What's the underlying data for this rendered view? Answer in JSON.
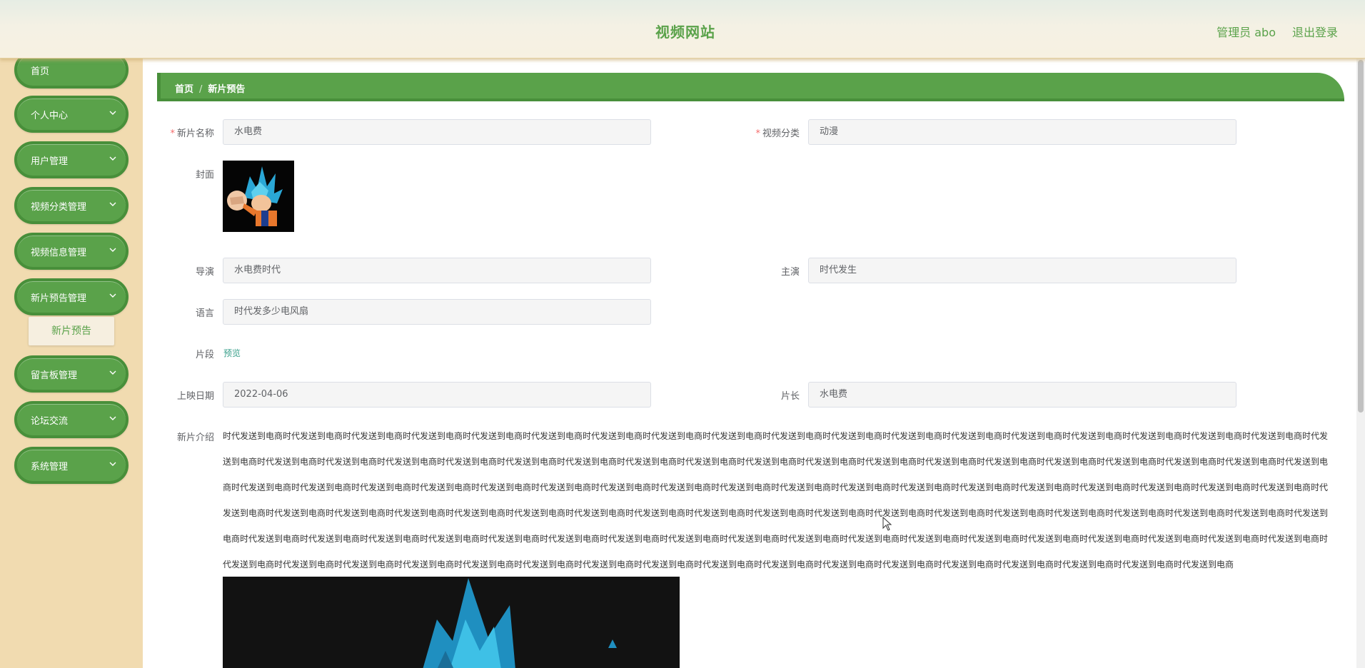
{
  "header": {
    "title": "视频网站",
    "user": "管理员 abo",
    "logout": "退出登录"
  },
  "sidebar": {
    "items": [
      {
        "label": "首页"
      },
      {
        "label": "个人中心"
      },
      {
        "label": "用户管理"
      },
      {
        "label": "视频分类管理"
      },
      {
        "label": "视频信息管理"
      },
      {
        "label": "新片预告管理"
      },
      {
        "label": "留言板管理"
      },
      {
        "label": "论坛交流"
      },
      {
        "label": "系统管理"
      }
    ],
    "submenu_active": "新片预告"
  },
  "breadcrumb": {
    "home": "首页",
    "separator": "/",
    "current": "新片预告"
  },
  "form": {
    "name_label": "新片名称",
    "name_value": "水电费",
    "category_label": "视频分类",
    "category_value": "动漫",
    "cover_label": "封面",
    "director_label": "导演",
    "director_value": "水电费时代",
    "actor_label": "主演",
    "actor_value": "时代发生",
    "language_label": "语言",
    "language_value": "时代发多少电风扇",
    "clip_label": "片段",
    "clip_link": "预览",
    "date_label": "上映日期",
    "date_value": "2022-04-06",
    "duration_label": "片长",
    "duration_value": "水电费",
    "intro_label": "新片介绍",
    "intro_text": "时代发送到电商时代发送到电商时代发送到电商时代发送到电商时代发送到电商时代发送到电商时代发送到电商时代发送到电商时代发送到电商时代发送到电商时代发送到电商时代发送到电商时代发送到电商时代发送到电商时代发送到电商时代发送到电商时代发送到电商时代发送到电商时代发送到电商时代发送到电商时代发送到电商时代发送到电商时代发送到电商时代发送到电商时代发送到电商时代发送到电商时代发送到电商时代发送到电商时代发送到电商时代发送到电商时代发送到电商时代发送到电商时代发送到电商时代发送到电商时代发送到电商时代发送到电商时代发送到电商时代发送到电商时代发送到电商时代发送到电商时代发送到电商时代发送到电商时代发送到电商时代发送到电商时代发送到电商时代发送到电商时代发送到电商时代发送到电商时代发送到电商时代发送到电商时代发送到电商时代发送到电商时代发送到电商时代发送到电商时代发送到电商时代发送到电商时代发送到电商时代发送到电商时代发送到电商时代发送到电商时代发送到电商时代发送到电商时代发送到电商时代发送到电商时代发送到电商时代发送到电商时代发送到电商时代发送到电商时代发送到电商时代发送到电商时代发送到电商时代发送到电商时代发送到电商时代发送到电商时代发送到电商时代发送到电商时代发送到电商时代发送到电商时代发送到电商时代发送到电商时代发送到电商时代发送到电商时代发送到电商时代发送到电商时代发送到电商时代发送到电商时代发送到电商时代发送到电商时代发送到电商时代发送到电商时代发送到电商时代发送到电商时代发送到电商时代发送到电商时代发送到电商时代发送到电商时代发送到电商时代发送到电商时代发送到电商时代发送到电商时代发送到电商时代发送到电商时代发送到电商时代发送到电商时代发送到电商时代发送到电商时代发送到电商时代发送到电商时代发送到电商"
  },
  "colors": {
    "brand_green": "#5aa24a",
    "brand_green_dark": "#488f3a",
    "sidebar_bg": "#f1dbb0",
    "required": "#f56c6c",
    "link": "#3aa08c"
  },
  "icons": {
    "menu_chevron": "chevron-down-icon",
    "cover": "anime-character-image",
    "cursor": "mouse-pointer-icon"
  }
}
